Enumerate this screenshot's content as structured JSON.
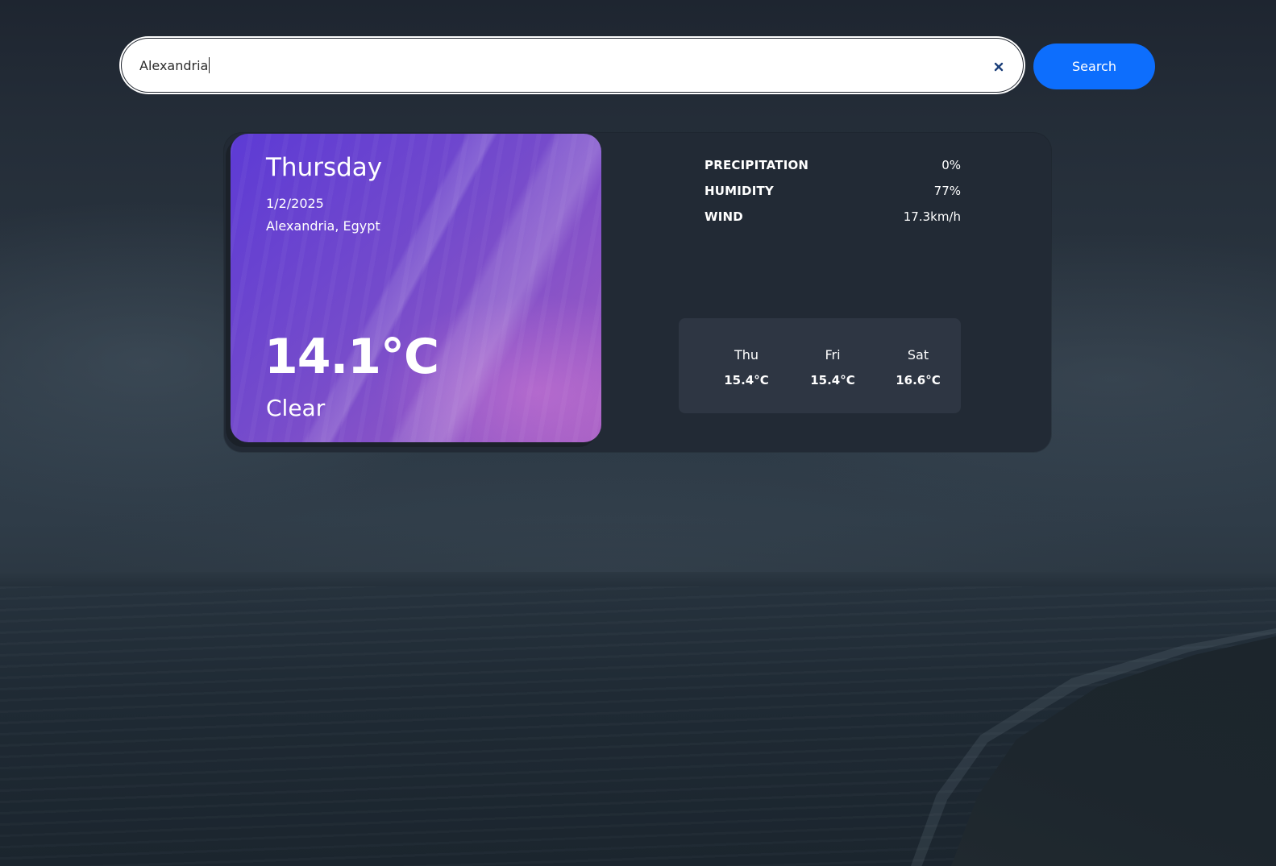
{
  "search": {
    "value": "Alexandria",
    "button_label": "Search",
    "clear_icon": "close-icon"
  },
  "current": {
    "day": "Thursday",
    "date": "1/2/2025",
    "location": "Alexandria, Egypt",
    "temperature": "14.1°C",
    "condition": "Clear"
  },
  "stats": [
    {
      "label": "PRECIPITATION",
      "value": "0%"
    },
    {
      "label": "HUMIDITY",
      "value": "77%"
    },
    {
      "label": "WIND",
      "value": "17.3km/h"
    }
  ],
  "forecast": [
    {
      "day": "Thu",
      "temp": "15.4°C"
    },
    {
      "day": "Fri",
      "temp": "15.4°C"
    },
    {
      "day": "Sat",
      "temp": "16.6°C"
    }
  ],
  "colors": {
    "accent": "#0d6efd",
    "card_background": "#222a35",
    "forecast_background": "#2e3643",
    "panel_gradient_start": "#623ce2",
    "panel_gradient_end": "#b264d6"
  }
}
